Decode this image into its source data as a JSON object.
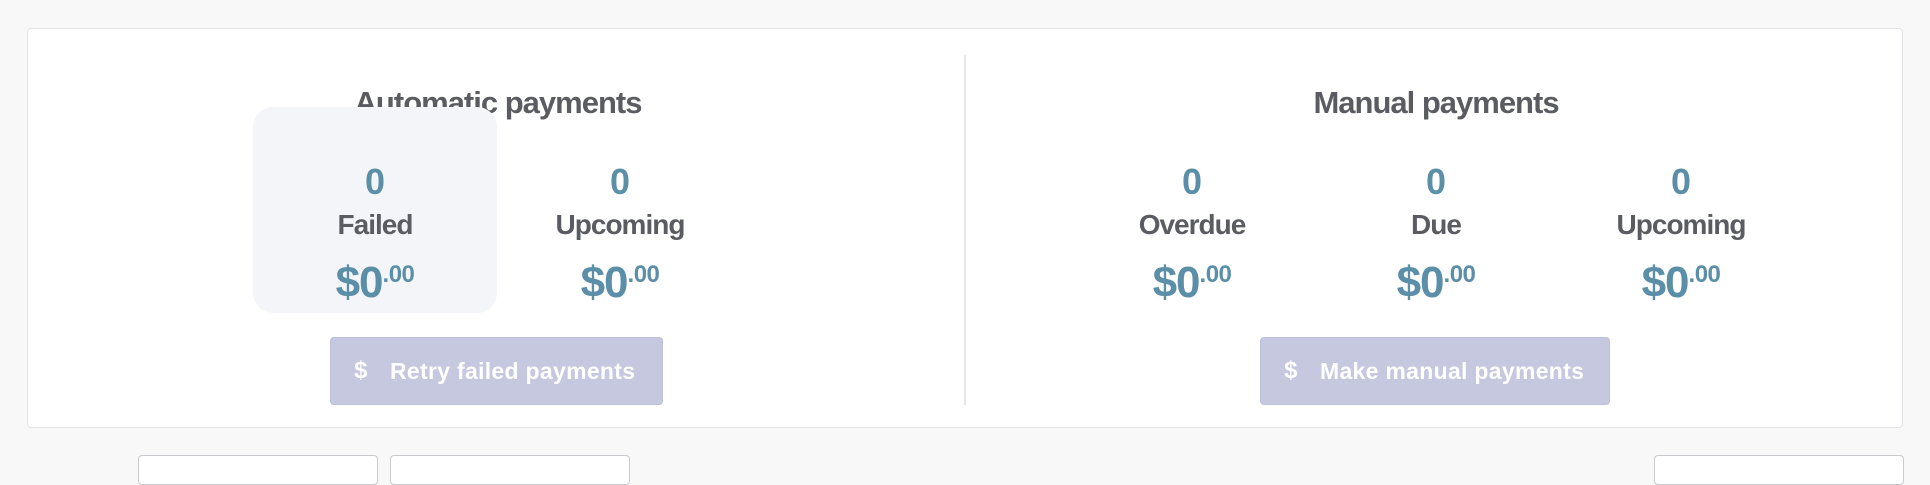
{
  "automatic": {
    "title": "Automatic payments",
    "failed": {
      "count": "0",
      "label": "Failed",
      "amount_main": "$0",
      "amount_cents": ".00"
    },
    "upcoming": {
      "count": "0",
      "label": "Upcoming",
      "amount_main": "$0",
      "amount_cents": ".00"
    },
    "button": {
      "icon": "dollar-icon",
      "label": "Retry failed payments"
    }
  },
  "manual": {
    "title": "Manual payments",
    "overdue": {
      "count": "0",
      "label": "Overdue",
      "amount_main": "$0",
      "amount_cents": ".00"
    },
    "due": {
      "count": "0",
      "label": "Due",
      "amount_main": "$0",
      "amount_cents": ".00"
    },
    "upcoming": {
      "count": "0",
      "label": "Upcoming",
      "amount_main": "$0",
      "amount_cents": ".00"
    },
    "button": {
      "icon": "dollar-icon",
      "label": "Make manual payments"
    }
  },
  "colors": {
    "accent_value": "#5b8fa8",
    "label_text": "#5b5c61",
    "button_disabled_bg": "#c5c8df",
    "highlight_bg": "#f3f5f9"
  }
}
